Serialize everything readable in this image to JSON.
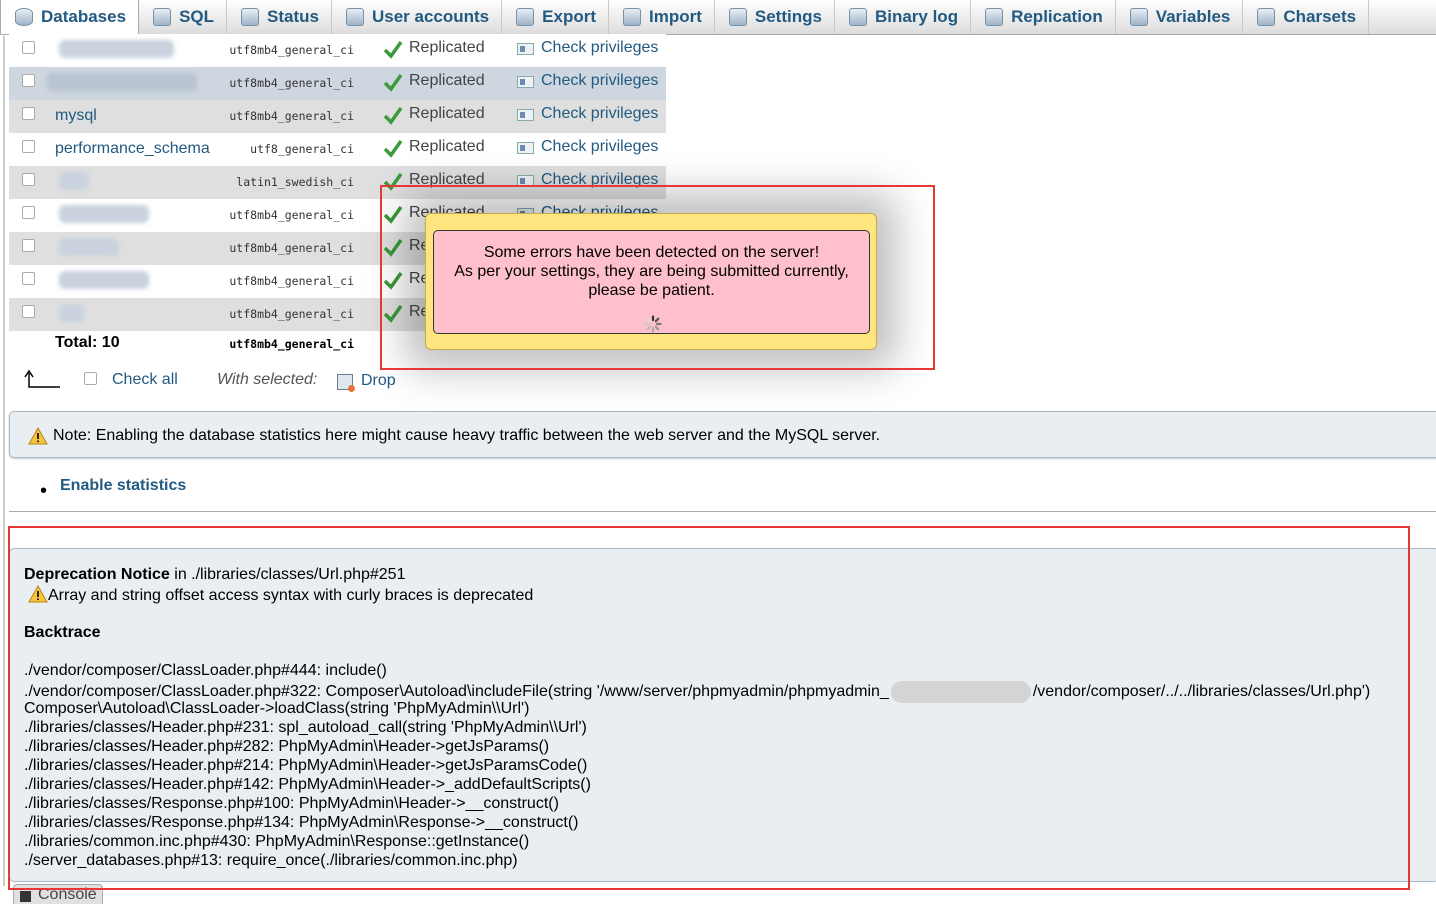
{
  "tabs": [
    {
      "label": "Databases",
      "icon": "database-icon",
      "active": true
    },
    {
      "label": "SQL",
      "icon": "sql-icon"
    },
    {
      "label": "Status",
      "icon": "status-icon"
    },
    {
      "label": "User accounts",
      "icon": "users-icon"
    },
    {
      "label": "Export",
      "icon": "export-icon"
    },
    {
      "label": "Import",
      "icon": "import-icon"
    },
    {
      "label": "Settings",
      "icon": "wrench-icon"
    },
    {
      "label": "Binary log",
      "icon": "binlog-icon"
    },
    {
      "label": "Replication",
      "icon": "replication-icon"
    },
    {
      "label": "Variables",
      "icon": "variables-icon"
    },
    {
      "label": "Charsets",
      "icon": "charsets-icon"
    }
  ],
  "databases": [
    {
      "name": "",
      "collation": "utf8mb4_general_ci",
      "replication": "Replicated",
      "action": "Check privileges"
    },
    {
      "name": "",
      "collation": "utf8mb4_general_ci",
      "replication": "Replicated",
      "action": "Check privileges"
    },
    {
      "name": "mysql",
      "collation": "utf8mb4_general_ci",
      "replication": "Replicated",
      "action": "Check privileges"
    },
    {
      "name": "performance_schema",
      "collation": "utf8_general_ci",
      "replication": "Replicated",
      "action": "Check privileges"
    },
    {
      "name": "",
      "collation": "latin1_swedish_ci",
      "replication": "Replicated",
      "action": "Check privileges"
    },
    {
      "name": "",
      "collation": "utf8mb4_general_ci",
      "replication": "Replicated",
      "action": "Check privileges"
    },
    {
      "name": "",
      "collation": "utf8mb4_general_ci",
      "replication": "Re",
      "action": ""
    },
    {
      "name": "",
      "collation": "utf8mb4_general_ci",
      "replication": "Re",
      "action": ""
    },
    {
      "name": "",
      "collation": "utf8mb4_general_ci",
      "replication": "Re",
      "action": ""
    }
  ],
  "total": {
    "label": "Total: 10",
    "collation": "utf8mb4_general_ci"
  },
  "actions": {
    "check_all": "Check all",
    "with_selected": "With selected:",
    "drop": "Drop"
  },
  "note": "Note: Enabling the database statistics here might cause heavy traffic between the web server and the MySQL server.",
  "enable_statistics": "Enable statistics",
  "error_popup": {
    "line1": "Some errors have been detected on the server!",
    "line2": "As per your settings, they are being submitted currently,",
    "line3": "please be patient."
  },
  "deprecation": {
    "title": "Deprecation Notice",
    "location": " in ./libraries/classes/Url.php#251",
    "message": "Array and string offset access syntax with curly braces is deprecated",
    "backtrace_title": "Backtrace",
    "trace": [
      "./vendor/composer/ClassLoader.php#444: include()",
      "./vendor/composer/ClassLoader.php#322: Composer\\Autoload\\includeFile(string '/www/server/phpmyadmin/phpmyadmin_",
      "Composer\\Autoload\\ClassLoader->loadClass(string 'PhpMyAdmin\\\\Url')",
      "./libraries/classes/Header.php#231: spl_autoload_call(string 'PhpMyAdmin\\\\Url')",
      "./libraries/classes/Header.php#282: PhpMyAdmin\\Header->getJsParams()",
      "./libraries/classes/Header.php#214: PhpMyAdmin\\Header->getJsParamsCode()",
      "./libraries/classes/Header.php#142: PhpMyAdmin\\Header->_addDefaultScripts()",
      "./libraries/classes/Response.php#100: PhpMyAdmin\\Header->__construct()",
      "./libraries/classes/Response.php#134: PhpMyAdmin\\Response->__construct()",
      "./libraries/common.inc.php#430: PhpMyAdmin\\Response::getInstance()",
      "./server_databases.php#13: require_once(./libraries/common.inc.php)"
    ],
    "trace_line2_tail": "/vendor/composer/../../libraries/classes/Url.php')"
  },
  "console": "Console"
}
